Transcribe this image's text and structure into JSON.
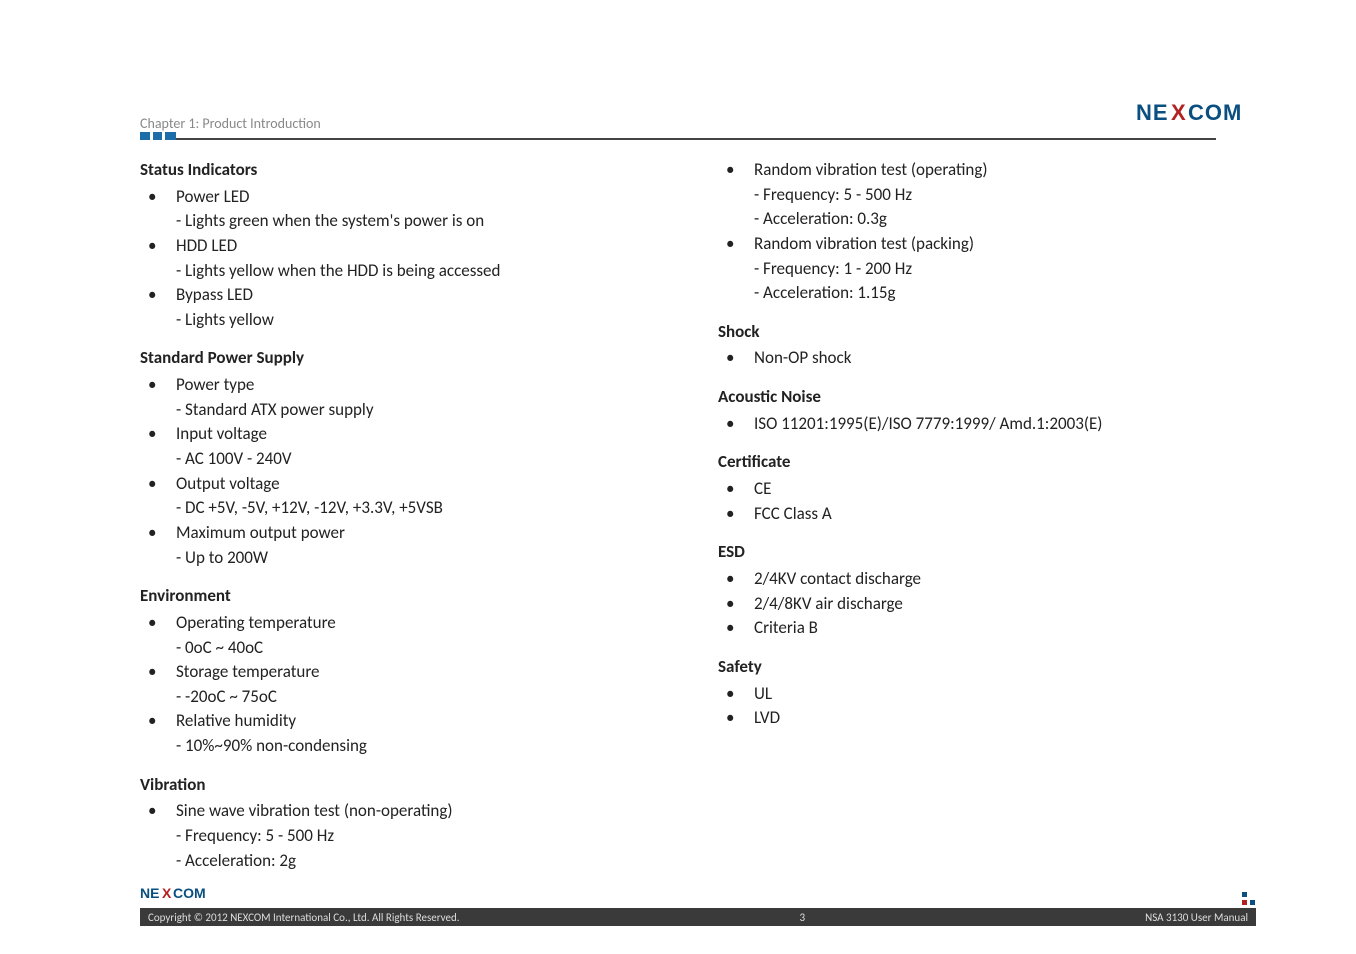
{
  "header": {
    "chapter": "Chapter 1: Product Introduction",
    "brand": "NEXCOM"
  },
  "left": {
    "s1": {
      "title": "Status Indicators",
      "i1": "Power LED",
      "i1a": "- Lights green when the system's power is on",
      "i2": "HDD LED",
      "i2a": "- Lights yellow when the HDD is being accessed",
      "i3": "Bypass LED",
      "i3a": "- Lights yellow"
    },
    "s2": {
      "title": "Standard Power Supply",
      "i1": "Power type",
      "i1a": "- Standard ATX power supply",
      "i2": "Input voltage",
      "i2a": "- AC 100V - 240V",
      "i3": "Output voltage",
      "i3a": "- DC +5V, -5V, +12V, -12V, +3.3V, +5VSB",
      "i4": "Maximum output power",
      "i4a": "- Up to 200W"
    },
    "s3": {
      "title": "Environment",
      "i1": "Operating temperature",
      "i1a": "- 0oC ~ 40oC",
      "i2": "Storage temperature",
      "i2a": "- -20oC ~ 75oC",
      "i3": "Relative humidity",
      "i3a": "- 10%~90% non-condensing"
    },
    "s4": {
      "title": "Vibration",
      "i1": "Sine wave vibration test (non-operating)",
      "i1a": "- Frequency: 5 - 500 Hz",
      "i1b": "- Acceleration: 2g"
    }
  },
  "right": {
    "cont": {
      "i1": "Random vibration test (operating)",
      "i1a": "- Frequency: 5 - 500 Hz",
      "i1b": "- Acceleration: 0.3g",
      "i2": "Random vibration test (packing)",
      "i2a": "- Frequency: 1 - 200 Hz",
      "i2b": "- Acceleration: 1.15g"
    },
    "s1": {
      "title": "Shock",
      "i1": "Non-OP shock"
    },
    "s2": {
      "title": "Acoustic Noise",
      "i1": "ISO 11201:1995(E)/ISO 7779:1999/ Amd.1:2003(E)"
    },
    "s3": {
      "title": "Certificate",
      "i1": "CE",
      "i2": "FCC Class A"
    },
    "s4": {
      "title": "ESD",
      "i1": "2/4KV contact discharge",
      "i2": "2/4/8KV air discharge",
      "i3": "Criteria B"
    },
    "s5": {
      "title": "Safety",
      "i1": "UL",
      "i2": "LVD"
    }
  },
  "footer": {
    "brand": "NEXCOM",
    "copyright": "Copyright © 2012 NEXCOM International Co., Ltd. All Rights Reserved.",
    "page": "3",
    "docref": "NSA 3130 User Manual"
  }
}
